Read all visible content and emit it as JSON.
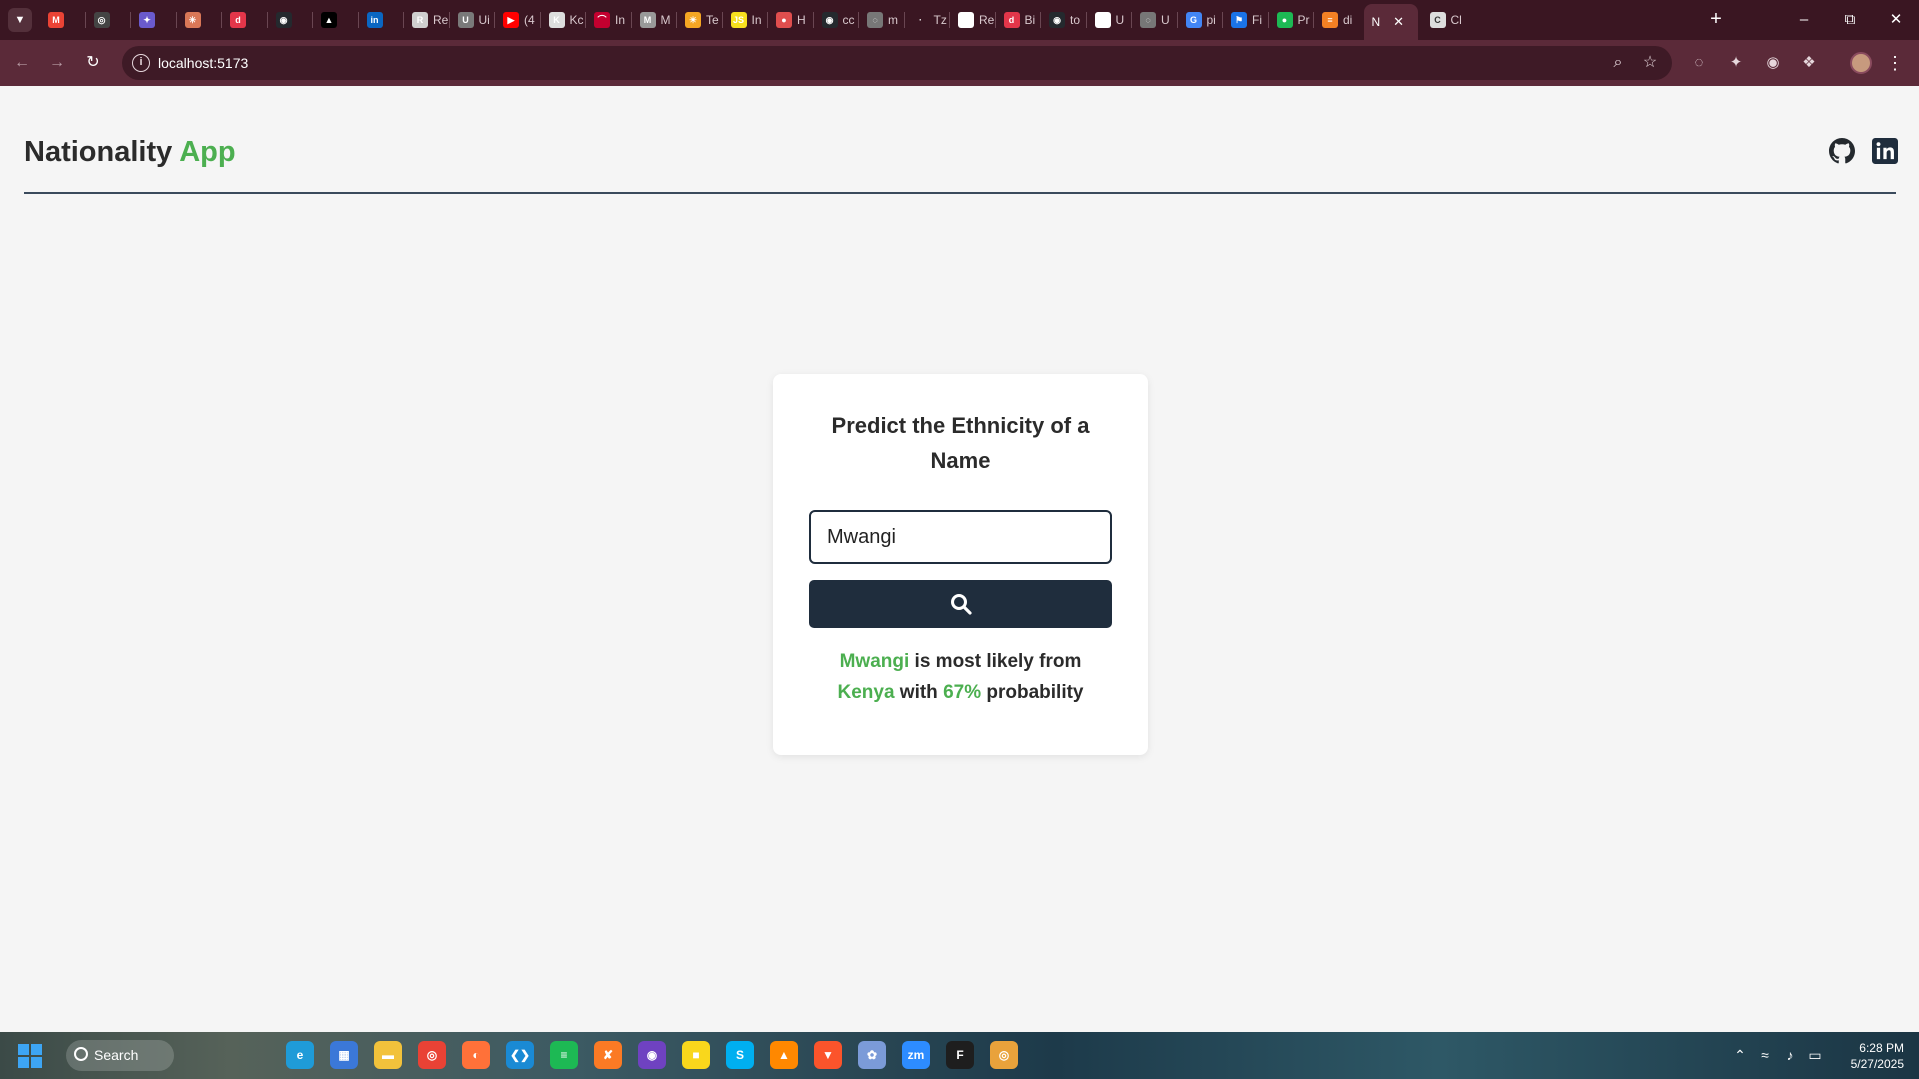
{
  "browser": {
    "tab_list_icon": "chevron-down-icon",
    "tabs": [
      {
        "label": "",
        "icon": "gmail-icon",
        "color": "#ea4335",
        "glyph": "M"
      },
      {
        "label": "",
        "icon": "openai-icon",
        "color": "#444444",
        "glyph": "◎"
      },
      {
        "label": "",
        "icon": "extension-icon",
        "color": "#6a5acd",
        "glyph": "✦"
      },
      {
        "label": "",
        "icon": "claude-icon",
        "color": "#d97757",
        "glyph": "✳"
      },
      {
        "label": "",
        "icon": "daily-dev-icon",
        "color": "#e3364a",
        "glyph": "d"
      },
      {
        "label": "",
        "icon": "github-icon",
        "color": "#24292e",
        "glyph": "◉"
      },
      {
        "label": "",
        "icon": "vercel-icon",
        "color": "#000000",
        "glyph": "▲"
      },
      {
        "label": "",
        "icon": "linkedin-icon",
        "color": "#0a66c2",
        "glyph": "in"
      },
      {
        "label": "Re",
        "icon": "page-icon",
        "color": "#cfcfcf",
        "glyph": "R"
      },
      {
        "label": "Ui",
        "icon": "page-icon",
        "color": "#7a7a7a",
        "glyph": "U"
      },
      {
        "label": "(4",
        "icon": "youtube-icon",
        "color": "#ff0000",
        "glyph": "▶"
      },
      {
        "label": "Kc",
        "icon": "page-icon",
        "color": "#dddddd",
        "glyph": "K"
      },
      {
        "label": "In",
        "icon": "arc-icon",
        "color": "#c3002f",
        "glyph": "⌒"
      },
      {
        "label": "M",
        "icon": "page-icon",
        "color": "#999999",
        "glyph": "M"
      },
      {
        "label": "Te",
        "icon": "sun-icon",
        "color": "#f5a623",
        "glyph": "☀"
      },
      {
        "label": "In",
        "icon": "js-icon",
        "color": "#f7df1e",
        "glyph": "JS"
      },
      {
        "label": "H",
        "icon": "circle-icon",
        "color": "#e04e4e",
        "glyph": "●"
      },
      {
        "label": "cc",
        "icon": "github-icon",
        "color": "#24292e",
        "glyph": "◉"
      },
      {
        "label": "m",
        "icon": "globe-icon",
        "color": "#777777",
        "glyph": "◌"
      },
      {
        "label": "Tz",
        "icon": "dot-icon",
        "color": "#3a1622",
        "glyph": "·"
      },
      {
        "label": "Re",
        "icon": "page-icon",
        "color": "#ffffff",
        "glyph": "R"
      },
      {
        "label": "Bi",
        "icon": "daily-dev-icon",
        "color": "#e3364a",
        "glyph": "d"
      },
      {
        "label": "to",
        "icon": "github-icon",
        "color": "#24292e",
        "glyph": "◉"
      },
      {
        "label": "U",
        "icon": "page-icon",
        "color": "#ffffff",
        "glyph": "U"
      },
      {
        "label": "U",
        "icon": "globe-icon",
        "color": "#777777",
        "glyph": "◌"
      },
      {
        "label": "pi",
        "icon": "google-icon",
        "color": "#4285f4",
        "glyph": "G"
      },
      {
        "label": "Fi",
        "icon": "flag-icon",
        "color": "#1a73e8",
        "glyph": "⚑"
      },
      {
        "label": "Pr",
        "icon": "green-dot-icon",
        "color": "#1db954",
        "glyph": "●"
      },
      {
        "label": "di",
        "icon": "stack-icon",
        "color": "#f48024",
        "glyph": "≡"
      }
    ],
    "active_tab": {
      "label": "N",
      "close_icon": "close-icon"
    },
    "after_tab": {
      "label": "Cl",
      "icon": "page-icon",
      "color": "#dddddd",
      "glyph": "C"
    },
    "new_tab_icon": "plus-icon",
    "window_controls": {
      "minimize": "–",
      "restore": "⧉",
      "close": "✕"
    },
    "nav": {
      "back": "←",
      "forward": "→",
      "reload": "↻"
    },
    "url": "localhost:5173",
    "info_icon": "info-icon",
    "zoom_icon": "zoom-icon",
    "star_icon": "star-icon",
    "extensions": [
      {
        "icon": "circle-extension-icon",
        "glyph": "◌"
      },
      {
        "icon": "colorful-extension-icon",
        "glyph": "✦"
      },
      {
        "icon": "badge-extension-icon",
        "glyph": "◉"
      },
      {
        "icon": "puzzle-icon",
        "glyph": "❖"
      }
    ],
    "menu_glyph": "⋮"
  },
  "app": {
    "brand_main": "Nationality",
    "brand_accent": "App",
    "accent_color": "#4caf50",
    "dark_color": "#1f2d3d",
    "social": [
      "github-icon",
      "linkedin-icon"
    ],
    "card": {
      "title": "Predict the Ethnicity of a Name",
      "input_value": "Mwangi",
      "search_icon": "search-icon",
      "result": {
        "name": "Mwangi",
        "text1": " is most likely from",
        "country": "Kenya",
        "text2": " with ",
        "probability": "67%",
        "text3": " probability"
      }
    }
  },
  "taskbar": {
    "search_label": "Search",
    "apps": [
      {
        "icon": "edge-icon",
        "color": "#1f9bd8",
        "glyph": "e"
      },
      {
        "icon": "store-icon",
        "color": "#3b78d8",
        "glyph": "▦"
      },
      {
        "icon": "folder-icon",
        "color": "#f2c23b",
        "glyph": "▬"
      },
      {
        "icon": "chrome-icon",
        "color": "#e94235",
        "glyph": "◎"
      },
      {
        "icon": "firefox-icon",
        "color": "#ff7139",
        "glyph": "◐"
      },
      {
        "icon": "vscode-icon",
        "color": "#1a8ad4",
        "glyph": "❮❯"
      },
      {
        "icon": "spotify-icon",
        "color": "#1db954",
        "glyph": "≡"
      },
      {
        "icon": "xampp-icon",
        "color": "#fb7a24",
        "glyph": "✘"
      },
      {
        "icon": "github-desktop-icon",
        "color": "#6f42c1",
        "glyph": "◉"
      },
      {
        "icon": "sticky-notes-icon",
        "color": "#f9d71c",
        "glyph": "■"
      },
      {
        "icon": "skype-icon",
        "color": "#00aff0",
        "glyph": "S"
      },
      {
        "icon": "vlc-icon",
        "color": "#ff8800",
        "glyph": "▲"
      },
      {
        "icon": "brave-icon",
        "color": "#fb542b",
        "glyph": "▼"
      },
      {
        "icon": "paint-icon",
        "color": "#7b9bd8",
        "glyph": "✿"
      },
      {
        "icon": "zoom-app-icon",
        "color": "#2d8cff",
        "glyph": "zm"
      },
      {
        "icon": "figma-icon",
        "color": "#1e1e1e",
        "glyph": "F"
      },
      {
        "icon": "chrome-canary-icon",
        "color": "#e9a23b",
        "glyph": "◎"
      }
    ],
    "tray": [
      {
        "icon": "chevron-up-icon",
        "glyph": "⌃"
      },
      {
        "icon": "wifi-icon",
        "glyph": "≈"
      },
      {
        "icon": "volume-icon",
        "glyph": "♪"
      },
      {
        "icon": "battery-icon",
        "glyph": "▭"
      }
    ],
    "time": "6:28 PM",
    "date": "5/27/2025"
  }
}
